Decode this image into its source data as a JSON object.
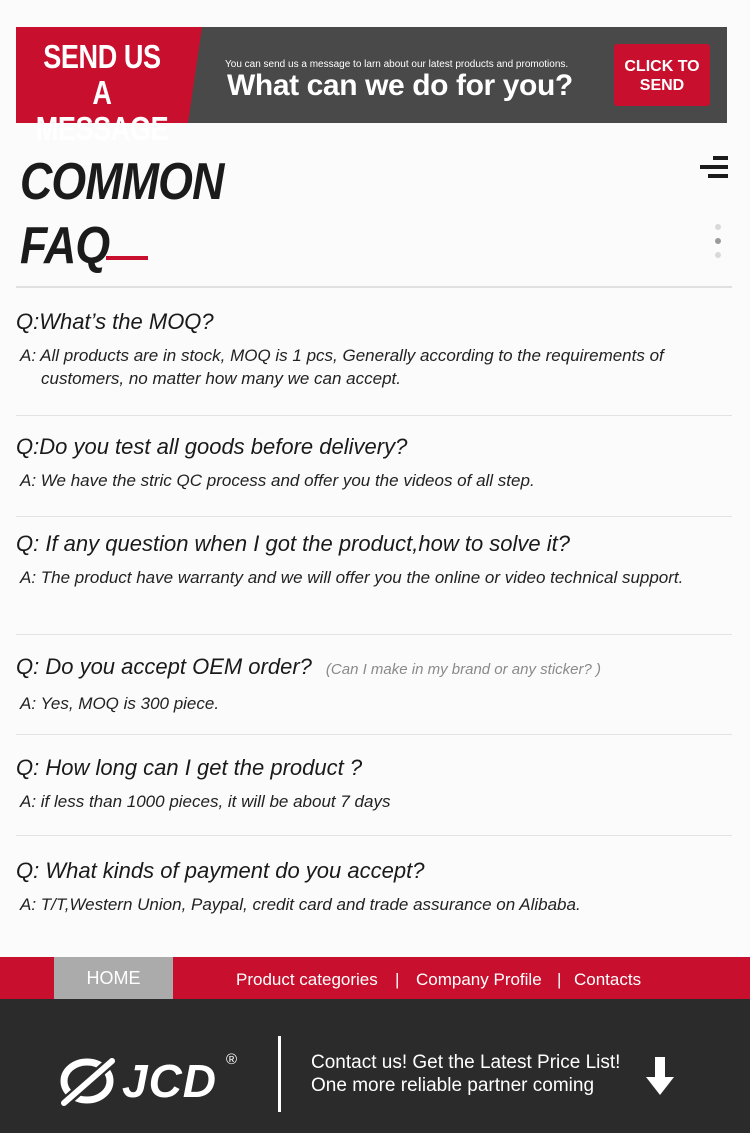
{
  "banner": {
    "title_line1": "SEND US A",
    "title_line2": "MESSAGE",
    "small_text": "You can send us a message to larn about our latest products and promotions.",
    "big_text": "What can we do for you?",
    "button_line1": "CLICK TO",
    "button_line2": "SEND"
  },
  "faq_heading": {
    "line1": "COMMON",
    "line2": "FAQ"
  },
  "faqs": [
    {
      "question": "Q:What’s the MOQ?",
      "note": "",
      "answer": "A: All products are in stock, MOQ is 1 pcs, Generally according to the requirements of customers, no matter how many we can accept."
    },
    {
      "question": "Q:Do you test all goods before delivery?",
      "note": "",
      "answer": "A: We have the stric QC process and offer you the videos of all step."
    },
    {
      "question": "Q: If any question when I got the product,how to solve it?",
      "note": "",
      "answer": "A: The product have warranty and we will offer you the online or video technical support."
    },
    {
      "question": "Q: Do you accept OEM order?",
      "note": "(Can I make in my brand or any sticker? )",
      "answer": "A: Yes, MOQ is 300 piece."
    },
    {
      "question": "Q: How long can I get the product ?",
      "note": "",
      "answer": "A: if less than 1000 pieces, it will be about 7 days"
    },
    {
      "question": "Q: What kinds of payment do you accept?",
      "note": "",
      "answer": "A: T/T,Western Union, Paypal, credit card and trade assurance on Alibaba."
    }
  ],
  "nav": {
    "home": "HOME",
    "product_categories": "Product categories",
    "company_profile": "Company Profile",
    "contacts": "Contacts",
    "separator": "|"
  },
  "footer": {
    "logo_text": "JCD",
    "logo_mark": "®",
    "line1": "Contact us! Get the Latest Price List!",
    "line2": "One more reliable partner coming"
  },
  "colors": {
    "accent_red": "#c8102e",
    "banner_gray": "#494949",
    "footer_dark": "#2b2b2b",
    "nav_home_gray": "#ababab"
  },
  "icons": {
    "menu": "menu-lines-icon",
    "logo_symbol": "slashed-circle-logo-icon",
    "scroll_down": "down-arrow-icon"
  }
}
